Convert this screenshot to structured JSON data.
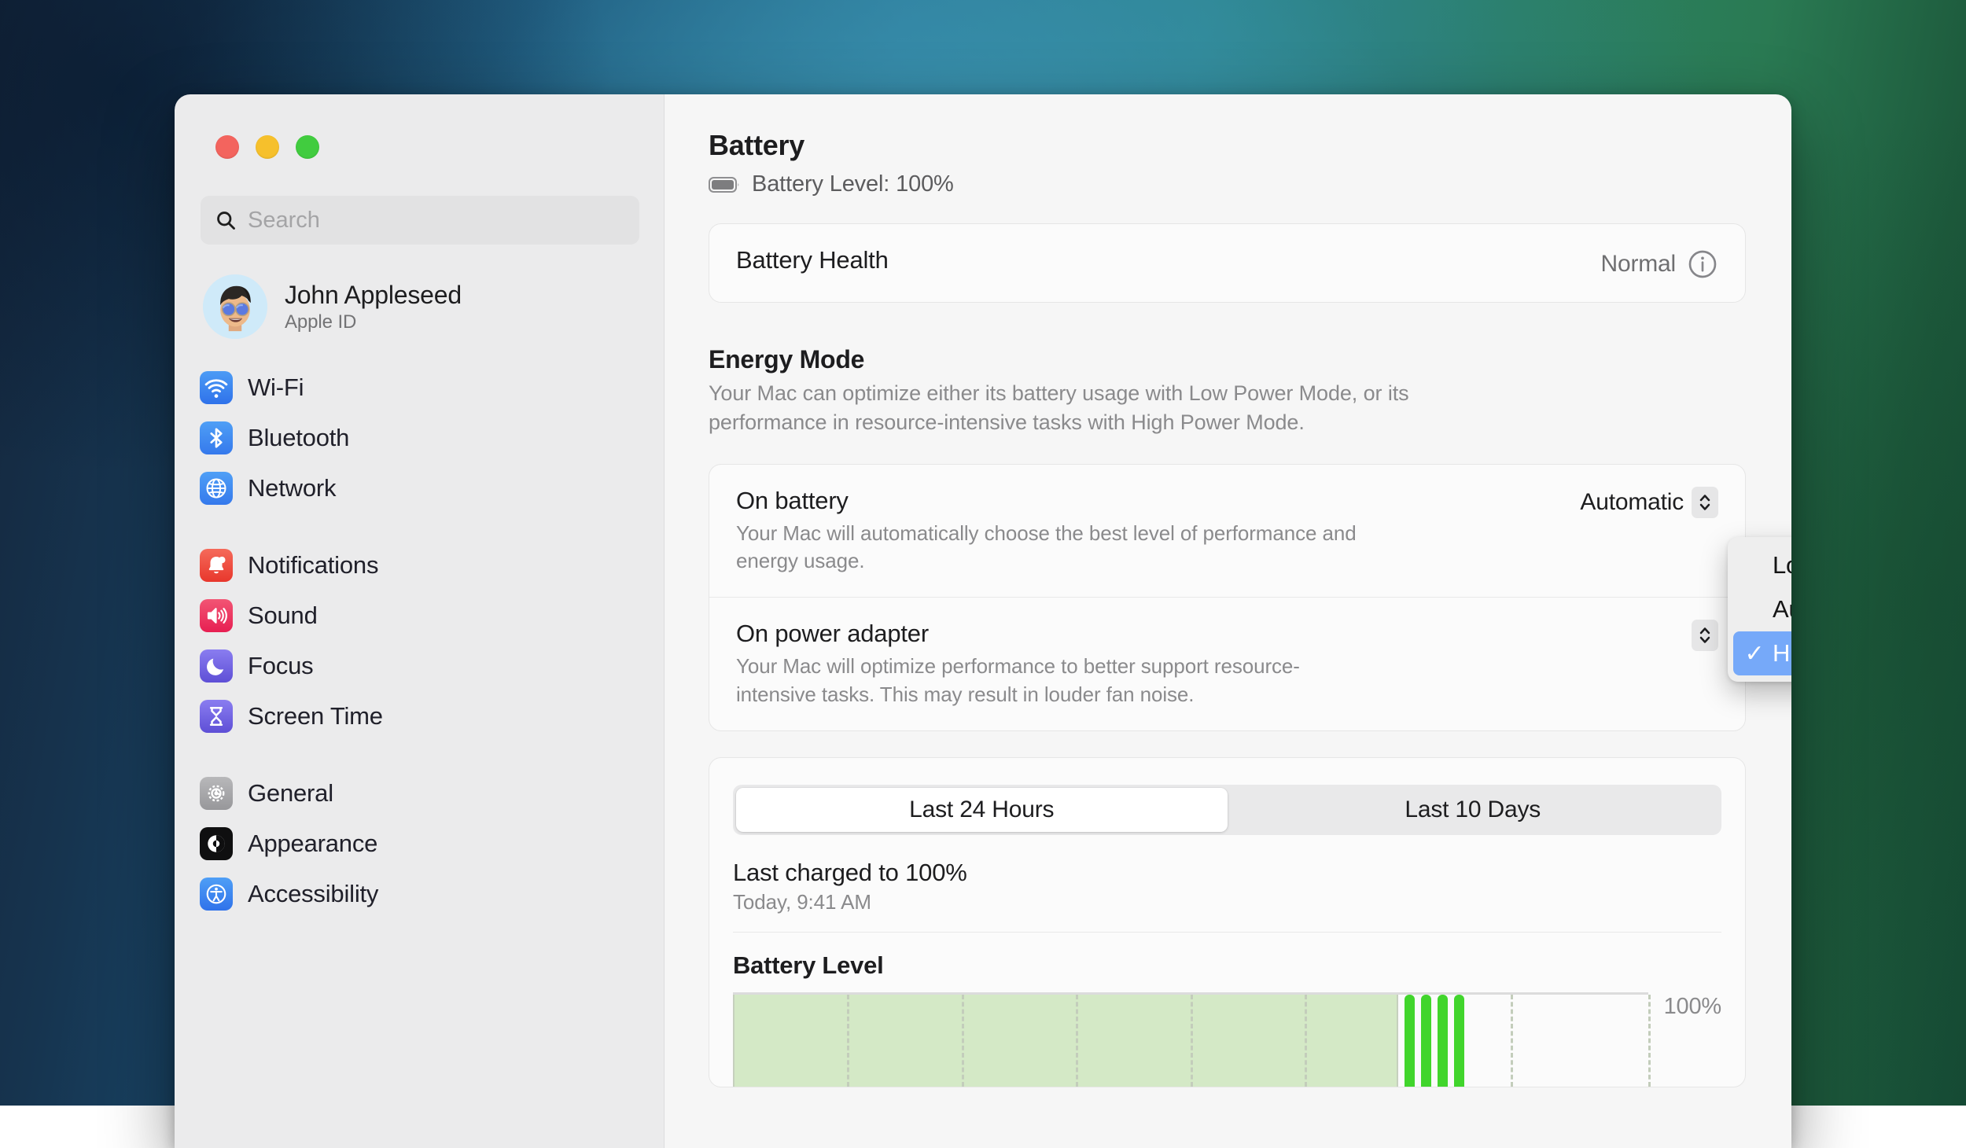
{
  "window": {
    "traffic_lights": [
      "close",
      "minimize",
      "zoom"
    ]
  },
  "sidebar": {
    "search": {
      "placeholder": "Search",
      "value": ""
    },
    "account": {
      "name": "John Appleseed",
      "subtitle": "Apple ID"
    },
    "groups": [
      {
        "items": [
          {
            "label": "Wi-Fi",
            "icon": "wifi-icon"
          },
          {
            "label": "Bluetooth",
            "icon": "bluetooth-icon"
          },
          {
            "label": "Network",
            "icon": "network-globe-icon"
          }
        ]
      },
      {
        "items": [
          {
            "label": "Notifications",
            "icon": "bell-icon"
          },
          {
            "label": "Sound",
            "icon": "speaker-icon"
          },
          {
            "label": "Focus",
            "icon": "moon-icon"
          },
          {
            "label": "Screen Time",
            "icon": "hourglass-icon"
          }
        ]
      },
      {
        "items": [
          {
            "label": "General",
            "icon": "gear-icon"
          },
          {
            "label": "Appearance",
            "icon": "appearance-contrast-icon"
          },
          {
            "label": "Accessibility",
            "icon": "accessibility-icon"
          }
        ]
      }
    ]
  },
  "main": {
    "title": "Battery",
    "battery_level_text": "Battery Level: 100%",
    "health": {
      "label": "Battery Health",
      "value": "Normal",
      "info_icon": "info-circle-icon"
    },
    "energy_mode": {
      "title": "Energy Mode",
      "description": "Your Mac can optimize either its battery usage with Low Power Mode, or its performance in resource-intensive tasks with High Power Mode.",
      "on_battery": {
        "title": "On battery",
        "description": "Your Mac will automatically choose the best level of performance and energy usage.",
        "selected": "Automatic"
      },
      "on_power_adapter": {
        "title": "On power adapter",
        "description": "Your Mac will optimize performance to better support resource-intensive tasks. This may result in louder fan noise."
      },
      "menu": {
        "options": [
          {
            "label": "Low Power",
            "checked": false
          },
          {
            "label": "Automatic",
            "checked": false
          },
          {
            "label": "High Power",
            "checked": true
          }
        ],
        "highlight_color": "#76a9f9"
      }
    },
    "usage": {
      "tabs": [
        {
          "label": "Last 24 Hours",
          "active": true
        },
        {
          "label": "Last 10 Days",
          "active": false
        }
      ],
      "last_charged_title": "Last charged to 100%",
      "last_charged_time": "Today, 9:41 AM",
      "chart_title": "Battery Level",
      "chart_max_label": "100%"
    }
  },
  "chart_data": {
    "type": "area",
    "title": "Battery Level",
    "xlabel": "",
    "ylabel": "",
    "ylim": [
      0,
      100
    ],
    "max_label": "100%",
    "grid": true,
    "fill_color": "#d4e9c6",
    "bar_color": "#41d52c",
    "area_extent_pct": 72.5,
    "gridlines_pct": [
      0,
      12.5,
      25,
      37.5,
      50,
      62.5,
      72.5,
      85,
      100
    ],
    "charging_bars_pct": [
      73.4,
      75.2,
      77.0,
      78.8
    ],
    "series": [
      {
        "name": "Battery Level",
        "values": [
          100,
          100,
          100,
          100,
          100,
          100,
          100
        ]
      }
    ]
  }
}
